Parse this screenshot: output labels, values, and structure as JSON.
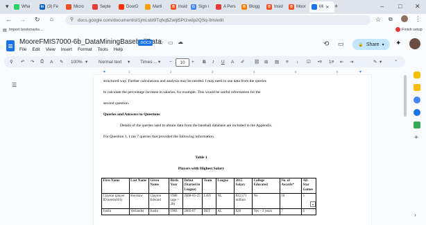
{
  "browser": {
    "tabs": [
      {
        "label": "Wha",
        "color": "#25d366"
      },
      {
        "label": "(3) Fe",
        "color": "#0a66c2"
      },
      {
        "label": "Micro",
        "color": "#f25022"
      },
      {
        "label": "Septe",
        "color": "#e53935"
      },
      {
        "label": "DoorD",
        "color": "#ff3008"
      },
      {
        "label": "Marti",
        "color": "#f6a000"
      },
      {
        "label": "Insid",
        "color": "#f4511e"
      },
      {
        "label": "Sign i",
        "color": "#4285f4"
      },
      {
        "label": "A Pers",
        "color": "#e53935"
      },
      {
        "label": "Blogg",
        "color": "#f57d00"
      },
      {
        "label": "Insid",
        "color": "#f4511e"
      },
      {
        "label": "Moor",
        "color": "#f4511e"
      },
      {
        "label": "Mi",
        "color": "#1a73e8"
      }
    ],
    "address": "docs.google.com/document/d/1jmLsbt9Tqhq5Zwljt5Pt1wdp2QSq-9m/edit",
    "bookmarks_label": "Import bookmarks...",
    "finish_setup": "Finish setup"
  },
  "doc": {
    "title": "MooreFMIS7000-6b_DataMiningBaseballData",
    "badge": ".DOCX",
    "menus": [
      "File",
      "Edit",
      "View",
      "Insert",
      "Format",
      "Tools",
      "Help"
    ],
    "share_label": "Share"
  },
  "toolbar": {
    "zoom": "100%",
    "style": "Normal text",
    "font": "Times ...",
    "font_size": "10",
    "minus": "−",
    "plus": "+"
  },
  "ruler": {
    "numbers": [
      "1",
      "2",
      "3",
      "4",
      "5",
      "6"
    ]
  },
  "content": {
    "line1": "structured way. Further calculations and analysis may be needed. I may need to use data from the queries",
    "line2": "to calculate the percentage increase in salaries, for example. This would be useful information for the",
    "line3": "second question.",
    "heading": "Queries and Answers to Questions",
    "para1": "Details of the queries used to obtain data from the baseball database are included in the Appendix.",
    "para2": "For Question 1, I ran 7 queries that provided the following information.",
    "table_number": "Table 1",
    "table_title": "Players with Highest Salary",
    "table": {
      "headers": [
        "First Name",
        "Last Name",
        "Given Name",
        "Birth Year",
        "Debut (Started in League)",
        "Team",
        "League",
        "2015 Salary",
        "College Educated",
        "No. of Awards*",
        "All-Star Games"
      ],
      "rows": [
        [
          "Clayton (player ID kershcl01)",
          "Kershaw",
          "Clayton Edward",
          "1988 (age = 28)",
          "2008-05-25",
          "LAN",
          "NL",
          "$32.571 million",
          "No",
          "10",
          "5"
        ],
        [
          "Justin",
          "Verlander",
          "Justin",
          "1983",
          "2005-07",
          "DET",
          "AL",
          "$28",
          "Yes – 3 years",
          "7",
          "6"
        ]
      ]
    }
  }
}
